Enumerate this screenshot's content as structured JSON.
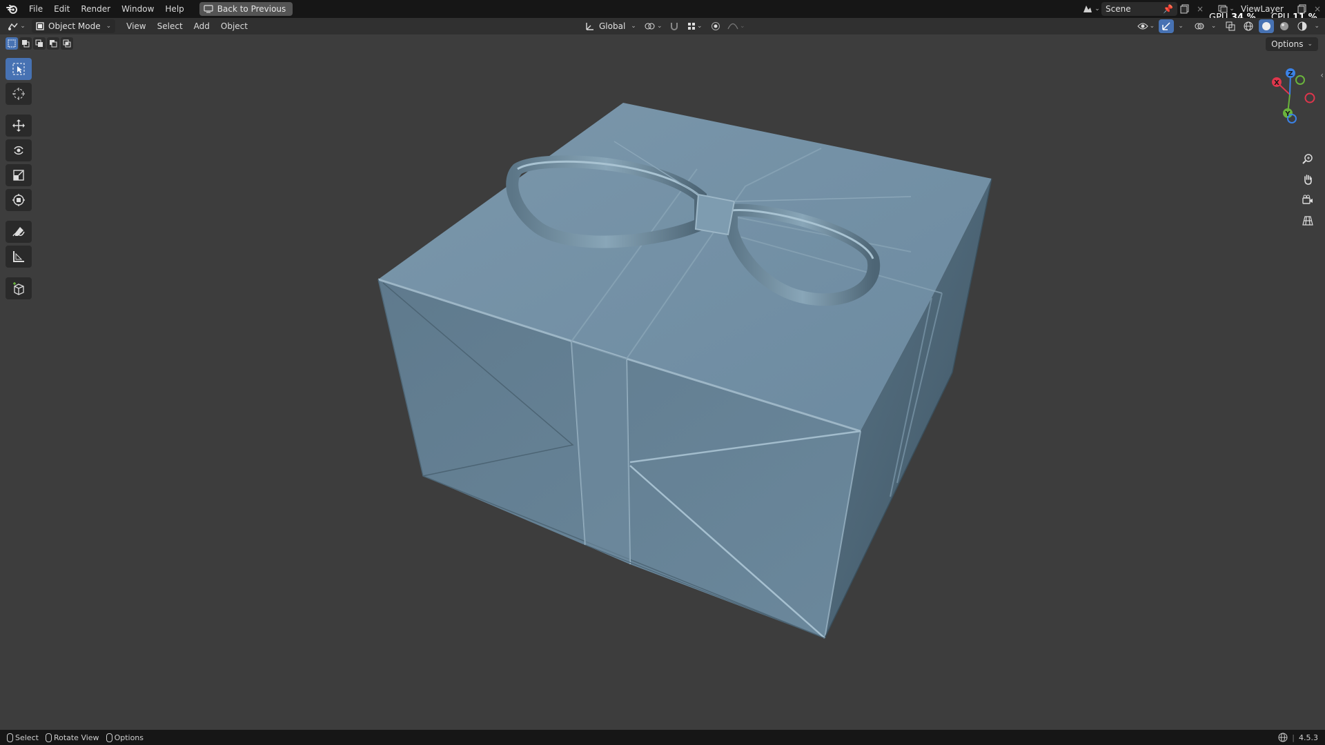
{
  "menubar": {
    "items": [
      "File",
      "Edit",
      "Render",
      "Window",
      "Help"
    ],
    "back_button": "Back to Previous",
    "scene": "Scene",
    "view_layer": "ViewLayer",
    "gpu_label": "GPU",
    "gpu_value": "34 %",
    "cpu_label": "CPU",
    "cpu_value": "11 %"
  },
  "header": {
    "mode": "Object Mode",
    "menus": [
      "View",
      "Select",
      "Add",
      "Object"
    ],
    "orientation": "Global"
  },
  "viewport": {
    "options": "Options",
    "background_color": "#3d3d3d",
    "object_color": "#6f8ea3",
    "gizmo_axes": [
      "X",
      "Y",
      "Z"
    ]
  },
  "toolbar": {
    "tools": [
      "select-box",
      "cursor",
      "move",
      "rotate",
      "scale",
      "transform",
      "annotate",
      "measure",
      "add-cube"
    ],
    "active": "select-box"
  },
  "statusbar": {
    "select": "Select",
    "rotate": "Rotate View",
    "options": "Options",
    "version": "4.5.3"
  },
  "colors": {
    "accent": "#4772b3",
    "x_axis": "#e0364c",
    "y_axis": "#6ab43c",
    "z_axis": "#3b82e6"
  }
}
